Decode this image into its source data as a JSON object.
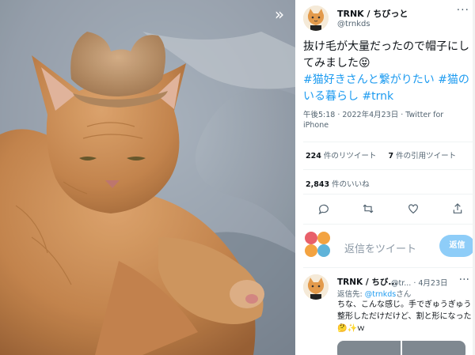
{
  "viewer": {
    "collapse_icon": "double-chevron-right-icon",
    "photo_alt": "Orange tabby cat wearing a hat made of its own fur"
  },
  "tweet": {
    "author_name": "TRNK / ちびっと",
    "author_handle": "@trnkds",
    "text_plain": "抜け毛が大量だったので帽子にしてみました😝",
    "hashtags": [
      "#猫好きさんと繋がりたい",
      "#猫のいる暮らし",
      "#trnk"
    ],
    "timestamp": "午後5:18 · 2022年4月23日 · Twitter for iPhone",
    "retweets_count": "224",
    "retweets_label": " 件のリツイート",
    "quotes_count": "7",
    "quotes_label": " 件の引用ツイート",
    "likes_count": "2,843",
    "likes_label": " 件のいいね",
    "more_label": "···"
  },
  "actions": [
    "reply-icon",
    "retweet-icon",
    "like-icon",
    "share-icon"
  ],
  "composer": {
    "placeholder": "返信をツイート",
    "reply_button": "返信"
  },
  "reply": {
    "author_name": "TRNK / ちび...",
    "handle_date": "@tr... · 4月23日",
    "reply_to_prefix": "返信先: ",
    "reply_to_handle": "@trnkds",
    "reply_to_suffix": "さん",
    "text": "ちな、こんな感じ。手でぎゅうぎゅう整形しただけだけど、割と形になった🤔✨ｗ",
    "more_label": "···"
  },
  "colors": {
    "accent": "#1d9bf0",
    "reply_button": "#8ecdf8",
    "muted": "#536471"
  }
}
